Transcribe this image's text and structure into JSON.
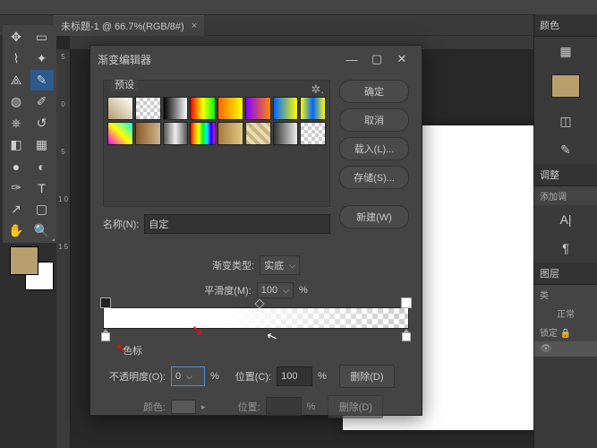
{
  "doc_tab": {
    "title": "未标题-1 @ 66.7%(RGB/8#)",
    "close": "×"
  },
  "ruler_marks": [
    "5",
    "0",
    "5",
    "1 0",
    "1 5"
  ],
  "panels": {
    "color": "颜色",
    "adjust": "调整",
    "add_adj": "添加调",
    "layers": "图层",
    "kind": "类",
    "normal": "正常",
    "lock": "锁定"
  },
  "dialog": {
    "title": "渐变编辑器",
    "presets_label": "预设",
    "buttons": {
      "ok": "确定",
      "cancel": "取消",
      "load": "载入(L)...",
      "save": "存储(S)...",
      "new": "新建(W)",
      "delete": "删除(D)",
      "delete2": "删除(D)"
    },
    "name_label": "名称(N):",
    "name_value": "自定",
    "type_label": "渐变类型:",
    "type_value": "实底",
    "smooth_label": "平滑度(M):",
    "smooth_value": "100",
    "pct": "%",
    "stops_label": "色标",
    "opacity_label": "不透明度(O):",
    "opacity_value": "0",
    "position_label": "位置(C):",
    "position_value": "100",
    "color_label": "颜色:",
    "position2_label": "位置:",
    "chevron": "▸"
  }
}
